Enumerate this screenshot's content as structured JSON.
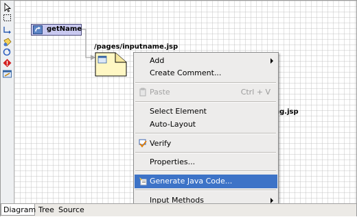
{
  "palette": {
    "tools": [
      {
        "name": "select-arrow-icon"
      },
      {
        "name": "marquee-select-icon"
      },
      {
        "name": "connection-icon"
      },
      {
        "name": "page-node-icon"
      },
      {
        "name": "action-node-icon"
      },
      {
        "name": "exception-node-icon"
      },
      {
        "name": "window-node-icon"
      }
    ]
  },
  "diagram": {
    "action_label": "getName",
    "page1_label": "/pages/inputname.jsp",
    "page2_label_partial": "ng.jsp"
  },
  "context_menu": {
    "items": {
      "add": "Add",
      "create_comment": "Create Comment...",
      "paste": "Paste",
      "paste_shortcut": "Ctrl + V",
      "select_element": "Select Element",
      "auto_layout": "Auto-Layout",
      "verify": "Verify",
      "properties": "Properties...",
      "generate_java_code": "Generate Java Code...",
      "input_methods": "Input Methods"
    }
  },
  "tabs": {
    "diagram": "Diagram",
    "tree": "Tree",
    "source": "Source"
  },
  "colors": {
    "highlight": "#3d73c7",
    "action_fill": "#c9c9f0",
    "page_fill": "#fff7c4"
  }
}
